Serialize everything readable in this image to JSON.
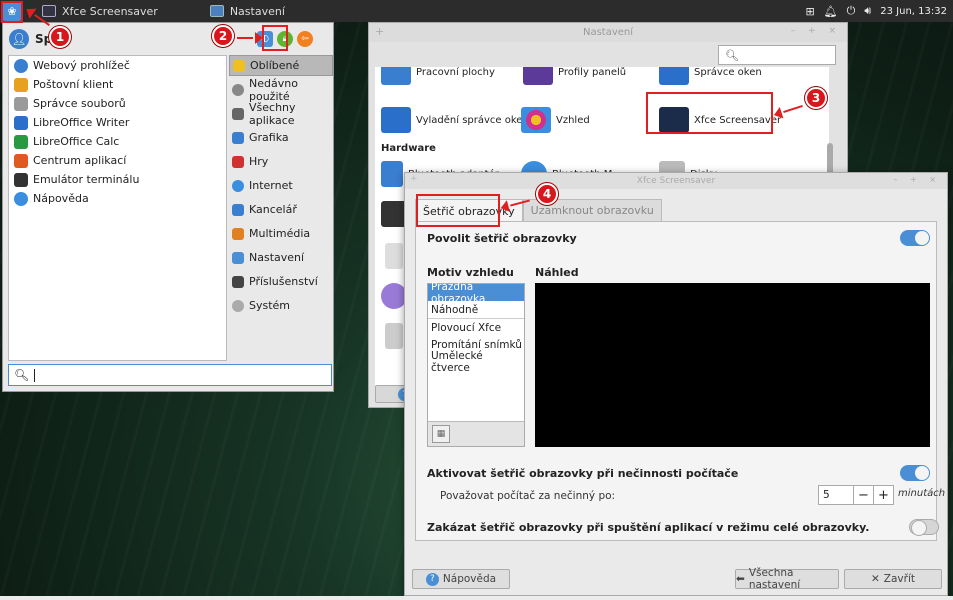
{
  "taskbar": {
    "tasks": [
      {
        "label": "Xfce Screensaver"
      },
      {
        "label": "Nastavení"
      }
    ],
    "clock": "23 Jun, 13:32"
  },
  "annotations": [
    "1",
    "2",
    "3",
    "4"
  ],
  "whisker": {
    "user": "Spr",
    "favorites": [
      {
        "label": "Webový prohlížeč",
        "color": "#3a7ed0"
      },
      {
        "label": "Poštovní klient",
        "color": "#e8a020"
      },
      {
        "label": "Správce souborů",
        "color": "#9a9a9a"
      },
      {
        "label": "LibreOffice Writer",
        "color": "#2a6fc9"
      },
      {
        "label": "LibreOffice Calc",
        "color": "#2a9a40"
      },
      {
        "label": "Centrum aplikací",
        "color": "#e05a20"
      },
      {
        "label": "Emulátor terminálu",
        "color": "#333333"
      },
      {
        "label": "Nápověda",
        "color": "#3a8ee0"
      }
    ],
    "categories": [
      {
        "label": "Oblíbené",
        "color": "#f0c020"
      },
      {
        "label": "Nedávno použité",
        "color": "#888888"
      },
      {
        "label": "Všechny aplikace",
        "color": "#666666"
      },
      {
        "label": "Grafika",
        "color": "#3a7ed0"
      },
      {
        "label": "Hry",
        "color": "#d03030"
      },
      {
        "label": "Internet",
        "color": "#3a8ee0"
      },
      {
        "label": "Kancelář",
        "color": "#3a7ed0"
      },
      {
        "label": "Multimédia",
        "color": "#e08020"
      },
      {
        "label": "Nastavení",
        "color": "#4a8fd6"
      },
      {
        "label": "Příslušenství",
        "color": "#444444"
      },
      {
        "label": "Systém",
        "color": "#aaaaaa"
      }
    ],
    "search_value": ""
  },
  "nastaveni": {
    "title": "Nastavení",
    "items_top": [
      "Pracovní plochy",
      "Profily panelů",
      "Správce oken"
    ],
    "items_row2": [
      "Vyladění správce oken",
      "Vzhled",
      "Xfce Screensaver"
    ],
    "hardware_label": "Hardware",
    "hw_items": [
      "Bluetooth adaptér",
      "Bluetooth M",
      "Disky"
    ]
  },
  "screensaver": {
    "title": "Xfce Screensaver",
    "tabs": [
      "Šetřič obrazovky",
      "Uzamknout obrazovku"
    ],
    "enable_label": "Povolit šetřič obrazovky",
    "theme_heading": "Motiv vzhledu",
    "preview_heading": "Náhled",
    "themes": [
      "Prázdná obrazovka",
      "Náhodně",
      "Plovoucí Xfce",
      "Promítání snímků",
      "Umělecké čtverce"
    ],
    "activate_label": "Aktivovat šetřič obrazovky při nečinnosti počítače",
    "idle_label": "Považovat počítač za nečinný po:",
    "idle_value": "5",
    "idle_unit": "minutách",
    "fullscreen_label": "Zakázat šetřič obrazovky při spuštění aplikací v režimu celé obrazovky.",
    "help_label": "Nápověda",
    "all_settings_label": "Všechna nastavení",
    "close_label": "Zavřít"
  }
}
